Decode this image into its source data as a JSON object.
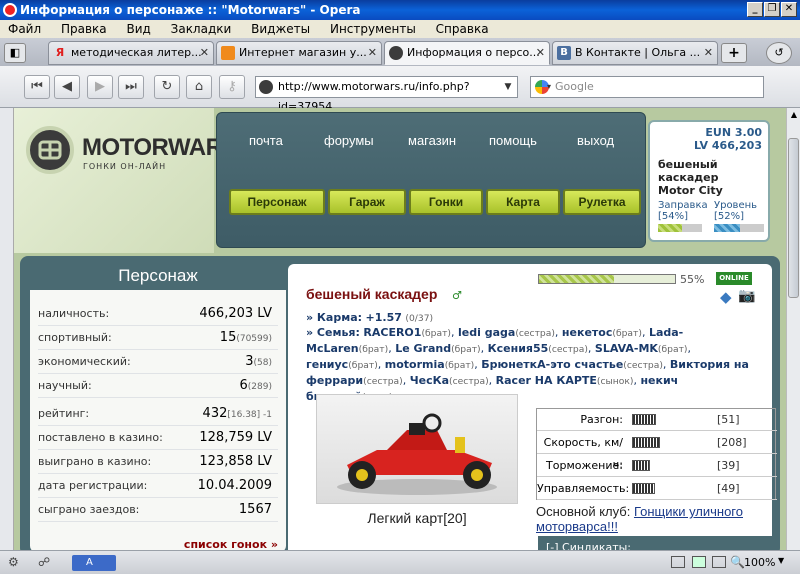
{
  "window": {
    "title": "Информация о персонаже :: \"Motorwars\" - Opera",
    "controls": [
      "_",
      "❐",
      "✕"
    ]
  },
  "menu": [
    "Файл",
    "Правка",
    "Вид",
    "Закладки",
    "Виджеты",
    "Инструменты",
    "Справка"
  ],
  "tabs": [
    {
      "label": "методическая литер...",
      "icon_color": "#e02020",
      "icon_letter": "Я",
      "active": false
    },
    {
      "label": "Интернет магазин у...",
      "icon_color": "#f08a1c",
      "icon_letter": "",
      "active": false
    },
    {
      "label": "Информация о персо...",
      "icon_color": "#3c3c3c",
      "icon_letter": "",
      "active": true
    },
    {
      "label": "В Контакте | Ольга ...",
      "icon_color": "#4b6fa0",
      "icon_letter": "В",
      "active": false
    }
  ],
  "address": {
    "url": "http://www.motorwars.ru/info.php?id=37954",
    "search_placeholder": "Google"
  },
  "site": {
    "logo": "MOTORWARS.RU",
    "logo_sub": "ГОНКИ ОН-ЛАЙН",
    "top_links": [
      "почта",
      "форумы",
      "магазин",
      "помощь",
      "выход"
    ],
    "green_buttons": [
      "Персонаж",
      "Гараж",
      "Гонки",
      "Карта",
      "Рулетка"
    ]
  },
  "user_box": {
    "eun": "EUN 3.00",
    "lv": "LV 466,203",
    "name1": "бешеный",
    "name2": "каскадер",
    "city": "Motor City",
    "fuel_label": "Заправка",
    "fuel_pct": "[54%]",
    "fuel_value": 54,
    "level_label": "Уровень",
    "level_pct": "[52%]",
    "level_value": 52
  },
  "character": {
    "header": "Персонаж",
    "stats": [
      {
        "label": "наличность:",
        "value": "466,203 LV",
        "sub": ""
      },
      {
        "label": "спортивный:",
        "value": "15",
        "sub": "(70599)"
      },
      {
        "label": "экономический:",
        "value": "3",
        "sub": "(58)"
      },
      {
        "label": "научный:",
        "value": "6",
        "sub": "(289)"
      },
      {
        "label": "рейтинг:",
        "value": "432",
        "sub": "[16.38]  -1"
      },
      {
        "label": "поставлено в казино:",
        "value": "128,759 LV",
        "sub": ""
      },
      {
        "label": "выиграно в казино:",
        "value": "123,858 LV",
        "sub": ""
      },
      {
        "label": "дата регистрации:",
        "value": "10.04.2009",
        "sub": ""
      },
      {
        "label": "сыграно заездов:",
        "value": "1567",
        "sub": ""
      }
    ],
    "races_link": "список гонок »"
  },
  "profile": {
    "name": "бешеный каскадер",
    "progress_pct": "55%",
    "progress_value": 55,
    "online": "ONLINE",
    "karma_label": "» Карма:",
    "karma_value": "+1.57",
    "karma_sub": "(0/37)",
    "family_label": "» Семья:",
    "family": [
      {
        "name": "RACERO1",
        "rel": "(брат)"
      },
      {
        "name": "ledi gaga",
        "rel": "(сестра)"
      },
      {
        "name": "некетос",
        "rel": "(брат)"
      },
      {
        "name": "Lada-McLaren",
        "rel": "(брат)"
      },
      {
        "name": "Le Grand",
        "rel": "(брат)"
      },
      {
        "name": "Ксения55",
        "rel": "(сестра)"
      },
      {
        "name": "SLAVA-MK",
        "rel": "(брат)"
      },
      {
        "name": "гениус",
        "rel": "(брат)"
      },
      {
        "name": "motormia",
        "rel": "(брат)"
      },
      {
        "name": "БрюнеткА-это счастье",
        "rel": "(сестра)"
      },
      {
        "name": "Виктория на феррари",
        "rel": "(сестра)"
      },
      {
        "name": "ЧесКа",
        "rel": "(сестра)"
      },
      {
        "name": "Racer НА КАРТЕ",
        "rel": "(сынок)"
      },
      {
        "name": "некич быстрый",
        "rel": "(папа)"
      }
    ],
    "car_name": "Легкий карт[20]",
    "car_stats": [
      {
        "label": "Разгон:",
        "value": "[51]",
        "level": 51
      },
      {
        "label": "Скорость, км/ч:",
        "value": "[208]",
        "level": 208
      },
      {
        "label": "Торможение:",
        "value": "[39]",
        "level": 39
      },
      {
        "label": "Управляемость:",
        "value": "[49]",
        "level": 49
      }
    ],
    "club_label": "Основной клуб:",
    "club_name1": "Гонщики уличного",
    "club_name2": "моторварса!!!",
    "syndicates": "[-]  Синдикаты:"
  },
  "status": {
    "zoom": "100%"
  }
}
